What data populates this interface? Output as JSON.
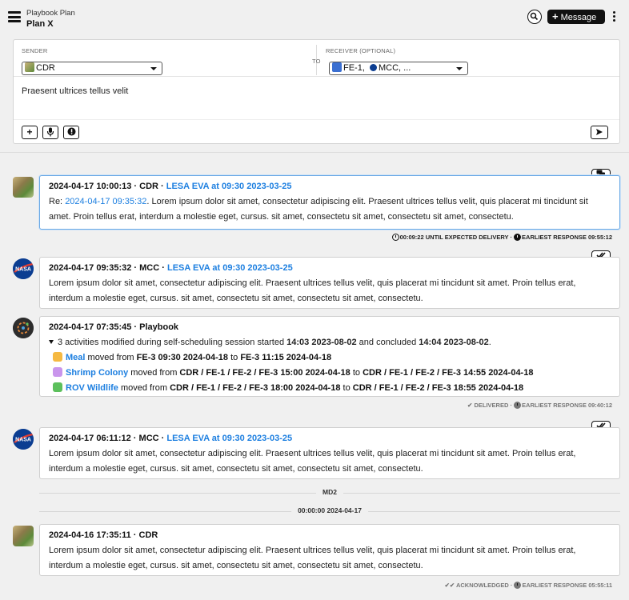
{
  "header": {
    "subtitle": "Playbook Plan",
    "title": "Plan X",
    "message_button": "Message"
  },
  "composer": {
    "sender_label": "SENDER",
    "sender_value": "CDR",
    "to_label": "TO",
    "receiver_label": "RECEIVER (OPTIONAL)",
    "receiver_value_a": "FE-1,",
    "receiver_value_b": "MCC, ...",
    "text": "Praesent ultrices tellus velit"
  },
  "messages": [
    {
      "head_meta": "2024-04-17 10:00:13 · CDR · ",
      "activity_link": "LESA EVA at 09:30 2023-03-25",
      "re_prefix": "Re: ",
      "re_link": "2024-04-17 09:35:32",
      "body_after": ". Lorem ipsum dolor sit amet, consectetur adipiscing elit. Praesent ultrices tellus velit, quis placerat mi tincidunt sit amet. Proin tellus erat, interdum a molestie eget, cursus. sit amet, consectetu sit amet, consectetu sit amet, consectetu.",
      "status": "00:09:22 UNTIL EXPECTED DELIVERY · ",
      "status2": "EARLIEST RESPONSE 09:55:12"
    },
    {
      "head_meta": "2024-04-17 09:35:32 · MCC · ",
      "activity_link": "LESA EVA at 09:30 2023-03-25",
      "body": "Lorem ipsum dolor sit amet, consectetur adipiscing elit. Praesent ultrices tellus velit, quis placerat mi tincidunt sit amet. Proin tellus erat, interdum a molestie eget, cursus. sit amet, consectetu sit amet, consectetu sit amet, consectetu."
    },
    {
      "head": "2024-04-17 07:35:45 · Playbook",
      "summary_a": "3 activities modified during self-scheduling session started ",
      "summary_b": "14:03 2023-08-02",
      "summary_c": " and concluded ",
      "summary_d": "14:04 2023-08-02",
      "summary_e": ".",
      "activities": [
        {
          "name": "Meal",
          "color": "#f5b942",
          "moved": " moved from ",
          "from": "FE-3 09:30 2024-04-18",
          "to_word": " to ",
          "to": "FE-3 11:15 2024-04-18"
        },
        {
          "name": "Shrimp Colony",
          "color": "#c995ec",
          "moved": " moved from ",
          "from": "CDR / FE-1 / FE-2 / FE-3 15:00 2024-04-18",
          "to_word": " to ",
          "to": "CDR / FE-1 / FE-2 / FE-3 14:55 2024-04-18"
        },
        {
          "name": "ROV Wildlife",
          "color": "#5cc05c",
          "moved": " moved from ",
          "from": "CDR / FE-1 / FE-2 / FE-3 18:00 2024-04-18",
          "to_word": " to ",
          "to": "CDR / FE-1 / FE-2 / FE-3 18:55 2024-04-18"
        }
      ],
      "status": "DELIVERED · ",
      "status2": "EARLIEST RESPONSE 09:40:12"
    },
    {
      "head_meta": "2024-04-17 06:11:12 · MCC · ",
      "activity_link": "LESA EVA at 09:30 2023-03-25",
      "body": "Lorem ipsum dolor sit amet, consectetur adipiscing elit. Praesent ultrices tellus velit, quis placerat mi tincidunt sit amet. Proin tellus erat, interdum a molestie eget, cursus. sit amet, consectetu sit amet, consectetu sit amet, consectetu."
    },
    {
      "head": "2024-04-16 17:35:11 · CDR",
      "body": "Lorem ipsum dolor sit amet, consectetur adipiscing elit. Praesent ultrices tellus velit, quis placerat mi tincidunt sit amet. Proin tellus erat, interdum a molestie eget, cursus. sit amet, consectetu sit amet, consectetu sit amet, consectetu.",
      "status": "ACKNOWLEDGED · ",
      "status2": "EARLIEST RESPONSE 05:55:11"
    }
  ],
  "separators": {
    "day_label": "MD2",
    "time_label": "00:00:00 2024-04-17"
  },
  "colors": {
    "link": "#1d7fe0",
    "selected_border": "#6aa9e6"
  }
}
